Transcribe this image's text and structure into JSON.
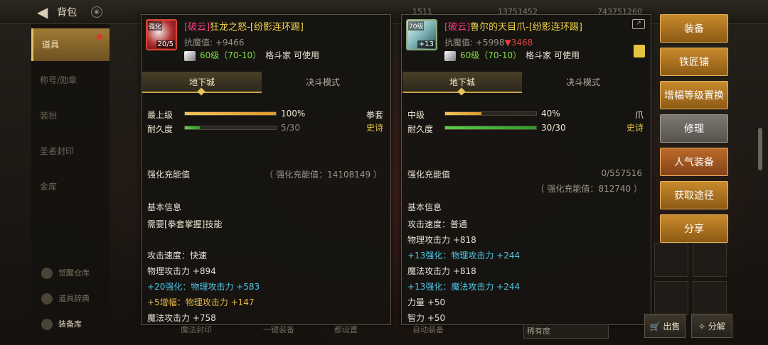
{
  "topbar": {
    "title": "背包",
    "currencies": [
      "1511",
      "13751452",
      "743751260"
    ]
  },
  "left_nav": {
    "items": [
      "道具",
      "称号/勋章",
      "装扮",
      "圣者封印",
      "金库"
    ],
    "bottom": [
      "觉醒仓库",
      "道具辞典",
      "装备库"
    ]
  },
  "left_panel": {
    "icon_tag": "强化",
    "icon_badge": "20/5",
    "name_tag": "[破云]",
    "name": "狂龙之怒-[纷影连环踢]",
    "kmz_label": "抗魔值: ",
    "kmz_value": "+9466",
    "level": "60级（70-10）",
    "class_usable": "格斗家 可使用",
    "tabs": [
      "地下城",
      "决斗模式"
    ],
    "stat1_label": "最上级",
    "stat1_value": "100%",
    "stat1_fill": 1.0,
    "stat2_label": "耐久度",
    "stat2_value": "5/30",
    "stat2_fill": 0.167,
    "weapon_type": "拳套",
    "rarity": "史诗",
    "charge_label": "强化充能值",
    "charge_value": "（ 强化充能值：14108149 ）",
    "basic_info": "基本信息",
    "lines": [
      {
        "text": "需要[拳套掌握]技能",
        "style": ""
      },
      {
        "text": "攻击速度：快速",
        "style": ""
      },
      {
        "text": "物理攻击力 +894",
        "style": ""
      },
      {
        "text": "+20强化：物理攻击力 +583",
        "style": "blue"
      },
      {
        "text": "+5增幅：物理攻击力 +147",
        "style": "gold"
      },
      {
        "text": "魔法攻击力 +758",
        "style": ""
      }
    ]
  },
  "right_panel": {
    "icon_tag": "70级",
    "icon_badge": "+13",
    "name_tag": "[破云]",
    "name": "鲁尔的天目爪-[纷影连环踢]",
    "kmz_label": "抗魔值: ",
    "kmz_value": "+5998",
    "kmz_diff": "▼3468",
    "level": "60级（70-10）",
    "class_usable": "格斗家 可使用",
    "tabs": [
      "地下城",
      "决斗模式"
    ],
    "stat1_label": "中级",
    "stat1_value": "40%",
    "stat1_fill": 0.4,
    "stat2_label": "耐久度",
    "stat2_value": "30/30",
    "stat2_fill": 1.0,
    "weapon_type": "爪",
    "rarity": "史诗",
    "charge_label": "强化充能值",
    "charge_progress": "0/557516",
    "charge_value": "（ 强化充能值：812740 ）",
    "basic_info": "基本信息",
    "lines": [
      {
        "text": "攻击速度：普通",
        "style": ""
      },
      {
        "text": "物理攻击力 +818",
        "style": ""
      },
      {
        "text": "+13强化：物理攻击力 +244",
        "style": "blue"
      },
      {
        "text": "魔法攻击力 +818",
        "style": ""
      },
      {
        "text": "+13强化：魔法攻击力 +244",
        "style": "blue"
      },
      {
        "text": "力量 +50",
        "style": ""
      },
      {
        "text": "智力 +50",
        "style": ""
      }
    ]
  },
  "side_buttons": [
    "装备",
    "铁匠铺",
    "增幅等级置换",
    "修理",
    "人气装备",
    "获取途径",
    "分享"
  ],
  "bottom": {
    "sell": "出售",
    "decompose": "分解",
    "dropdown": "稀有度",
    "tools": [
      "魔法封印",
      "一键装备",
      "都设置",
      "自动装备"
    ]
  }
}
